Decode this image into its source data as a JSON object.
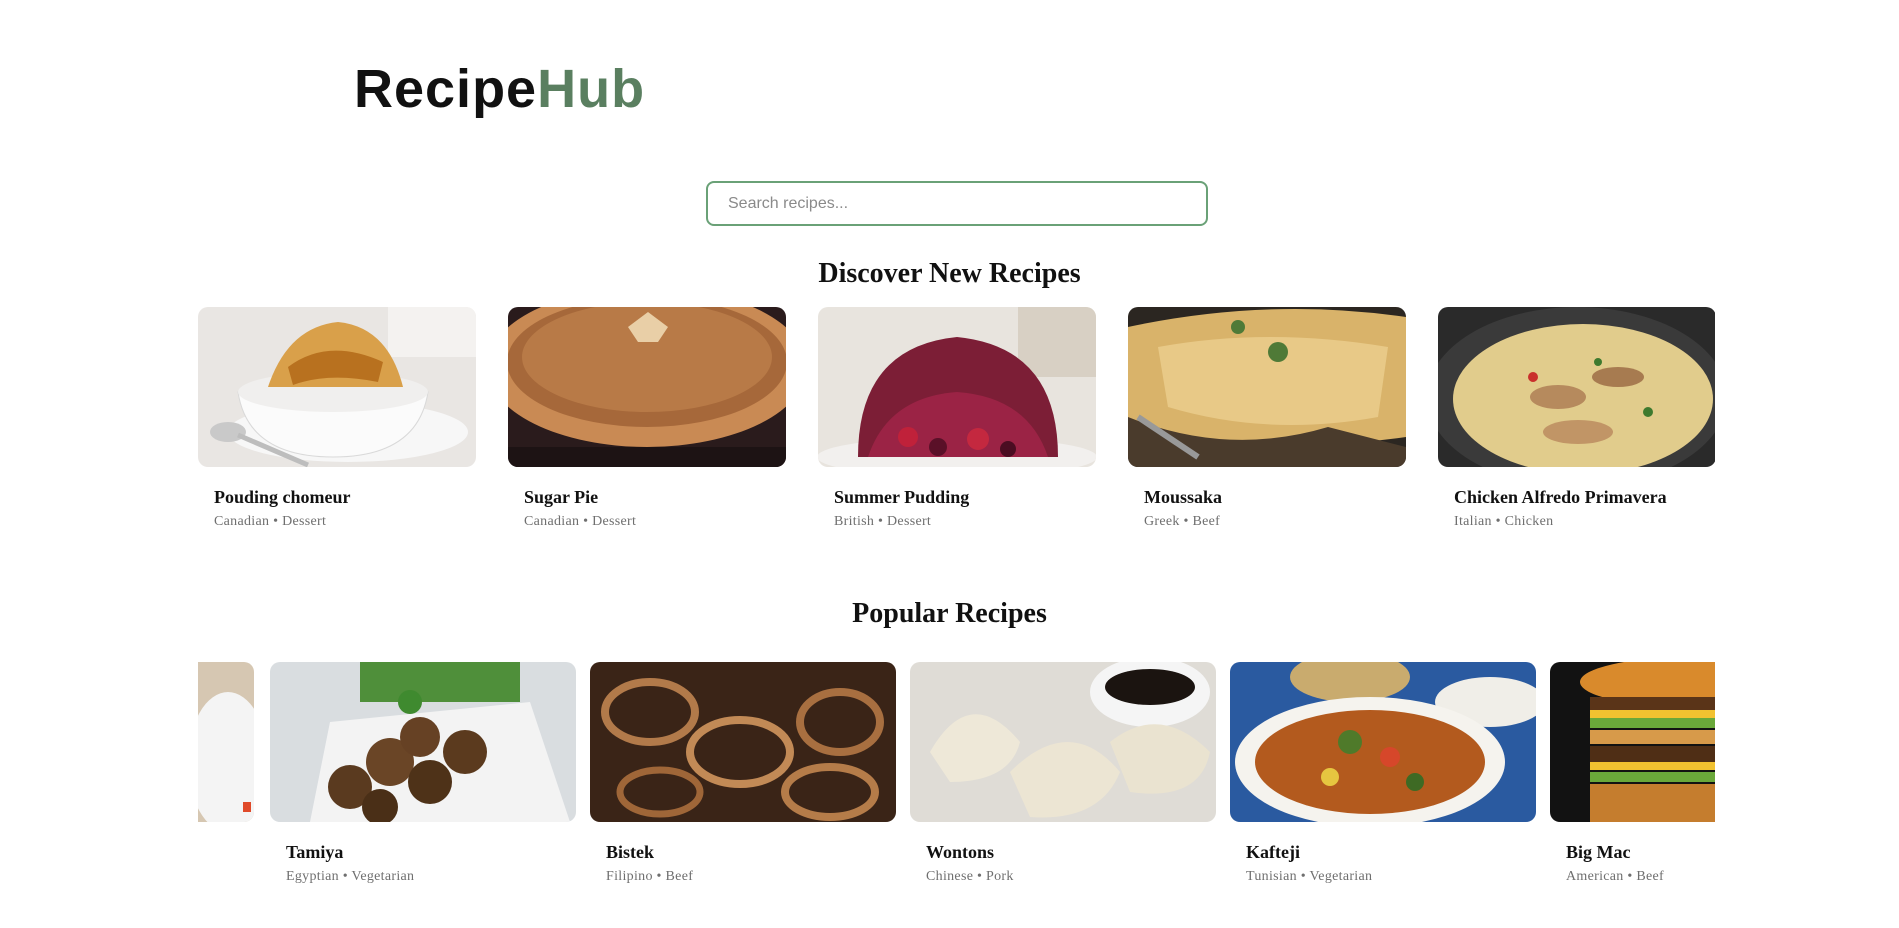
{
  "brand": {
    "part1": "Recipe",
    "part2": "Hub",
    "accent_color": "#5a7f60"
  },
  "search": {
    "placeholder": "Search recipes...",
    "value": ""
  },
  "discover": {
    "title": "Discover New Recipes",
    "cards": [
      {
        "name": "Pouding chomeur",
        "area": "Canadian",
        "category": "Dessert",
        "meta": "Canadian • Dessert"
      },
      {
        "name": "Sugar Pie",
        "area": "Canadian",
        "category": "Dessert",
        "meta": "Canadian • Dessert"
      },
      {
        "name": "Summer Pudding",
        "area": "British",
        "category": "Dessert",
        "meta": "British • Dessert"
      },
      {
        "name": "Moussaka",
        "area": "Greek",
        "category": "Beef",
        "meta": "Greek • Beef"
      },
      {
        "name": "Chicken Alfredo Primavera",
        "area": "Italian",
        "category": "Chicken",
        "meta": "Italian • Chicken"
      }
    ]
  },
  "popular": {
    "title": "Popular Recipes",
    "cards": [
      {
        "name": "Tamiya",
        "area": "Egyptian",
        "category": "Vegetarian",
        "meta": "Egyptian • Vegetarian"
      },
      {
        "name": "Bistek",
        "area": "Filipino",
        "category": "Beef",
        "meta": "Filipino • Beef"
      },
      {
        "name": "Wontons",
        "area": "Chinese",
        "category": "Pork",
        "meta": "Chinese • Pork"
      },
      {
        "name": "Kafteji",
        "area": "Tunisian",
        "category": "Vegetarian",
        "meta": "Tunisian • Vegetarian"
      },
      {
        "name": "Big Mac",
        "area": "American",
        "category": "Beef",
        "meta": "American • Beef"
      }
    ]
  }
}
